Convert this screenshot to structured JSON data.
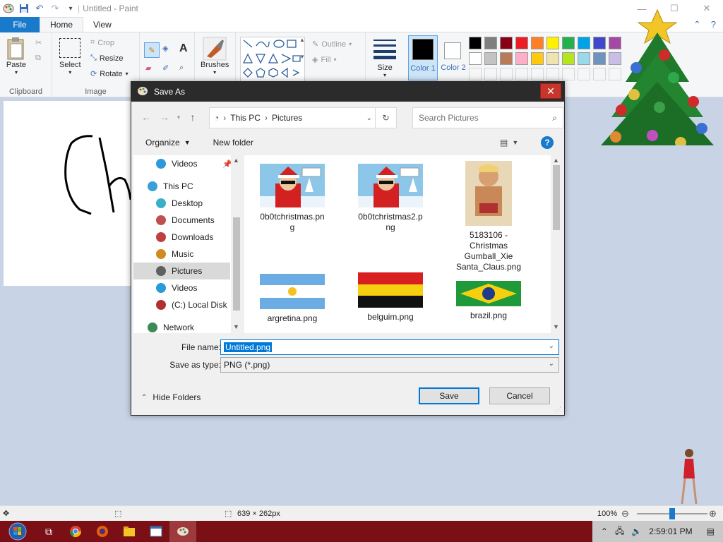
{
  "window": {
    "title": "Untitled - Paint"
  },
  "menu": {
    "file": "File",
    "tabs": [
      "Home",
      "View"
    ]
  },
  "ribbon": {
    "clipboard": {
      "paste": "Paste",
      "label": "Clipboard"
    },
    "image": {
      "select": "Select",
      "crop": "Crop",
      "resize": "Resize",
      "rotate": "Rotate",
      "label": "Image"
    },
    "tools": {
      "brushes": "Brushes"
    },
    "shapes": {
      "outline": "Outline",
      "fill": "Fill"
    },
    "size": "Size",
    "color1": "Color 1",
    "color2": "Color 2",
    "palette_row1": [
      "#000000",
      "#7f7f7f",
      "#880015",
      "#ed1c24",
      "#ff7f27",
      "#fff200",
      "#22b14c",
      "#00a2e8",
      "#3f48cc",
      "#a349a4"
    ],
    "palette_row2": [
      "#ffffff",
      "#c3c3c3",
      "#b97a57",
      "#ffaec9",
      "#ffc90e",
      "#efe4b0",
      "#b5e61d",
      "#99d9ea",
      "#7092be",
      "#c8bfe7"
    ]
  },
  "dialog": {
    "title": "Save As",
    "breadcrumb": [
      "This PC",
      "Pictures"
    ],
    "search_placeholder": "Search Pictures",
    "organize": "Organize",
    "new_folder": "New folder",
    "nav": [
      {
        "label": "Videos",
        "icon": "video-folder-icon"
      },
      {
        "label": "This PC",
        "icon": "pc-icon"
      },
      {
        "label": "Desktop",
        "icon": "desktop-folder-icon"
      },
      {
        "label": "Documents",
        "icon": "documents-folder-icon"
      },
      {
        "label": "Downloads",
        "icon": "downloads-folder-icon"
      },
      {
        "label": "Music",
        "icon": "music-folder-icon"
      },
      {
        "label": "Pictures",
        "icon": "pictures-folder-icon"
      },
      {
        "label": "Videos",
        "icon": "video-folder-icon"
      },
      {
        "label": "(C:) Local Disk",
        "icon": "disk-icon"
      },
      {
        "label": "Network",
        "icon": "network-icon"
      }
    ],
    "files": [
      {
        "name": "0b0tchristmas.png",
        "l1": "0b0tchristmas.pn",
        "l2": "g"
      },
      {
        "name": "0b0tchristmas2.png",
        "l1": "0b0tchristmas2.p",
        "l2": "ng"
      },
      {
        "name": "5183106 - Christmas Gumball_Xie Santa_Claus.png",
        "l1": "5183106 -",
        "l2": "Christmas",
        "l3": "Gumball_Xie",
        "l4": "Santa_Claus.png"
      },
      {
        "name": "argretina.png",
        "l1": "argretina.png"
      },
      {
        "name": "belguim.png",
        "l1": "belguim.png"
      },
      {
        "name": "brazil.png",
        "l1": "brazil.png"
      }
    ],
    "file_name_label": "File name:",
    "file_name_value": "Untitled.png",
    "save_type_label": "Save as type:",
    "save_type_value": "PNG (*.png)",
    "hide_folders": "Hide Folders",
    "save": "Save",
    "cancel": "Cancel"
  },
  "status": {
    "dimensions": "639 × 262px",
    "zoom": "100%"
  },
  "taskbar": {
    "time": "2:59:01 PM"
  }
}
